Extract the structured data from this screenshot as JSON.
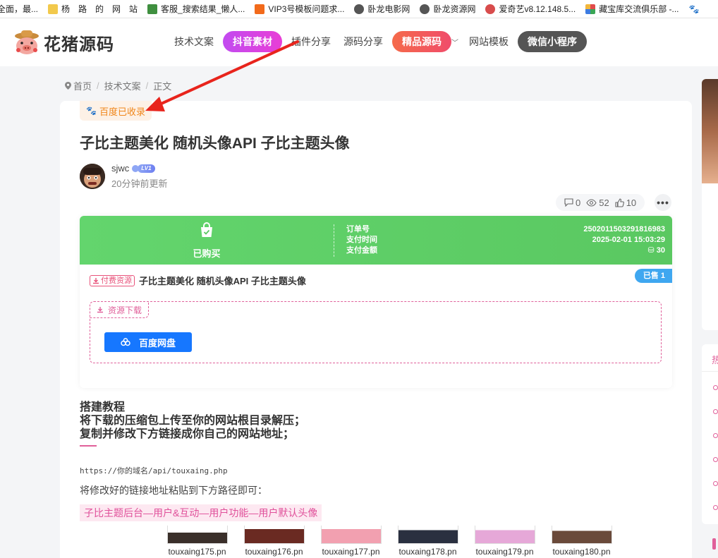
{
  "bookmarks": [
    {
      "label": "全面，最...",
      "icon": "page-icon",
      "color": "#6a8bd8"
    },
    {
      "label": "杨　路　的　网　站",
      "icon": "folder-icon",
      "color": "#f2c94c"
    },
    {
      "label": "客服_搜索结果_懒人...",
      "icon": "site-icon",
      "color": "#3f8f3f"
    },
    {
      "label": "VIP3号模板问题求...",
      "icon": "z-icon",
      "color": "#f26a1b"
    },
    {
      "label": "卧龙电影网",
      "icon": "globe-icon",
      "color": "#555555"
    },
    {
      "label": "卧龙资源网",
      "icon": "globe-icon",
      "color": "#555555"
    },
    {
      "label": "爱奇艺v8.12.148.5...",
      "icon": "site-icon",
      "color": "#d84c4c"
    },
    {
      "label": "藏宝库交流俱乐部 -...",
      "icon": "grid-icon",
      "color": "#e14b4b"
    }
  ],
  "header": {
    "logo_text": "花猪源码",
    "nav": [
      {
        "label": "技术文案",
        "style": "plain"
      },
      {
        "label": "抖音素材",
        "style": "purple"
      },
      {
        "label": "插件分享",
        "style": "plain"
      },
      {
        "label": "源码分享",
        "style": "plain"
      },
      {
        "label": "精品源码",
        "style": "red"
      },
      {
        "label": "网站模板",
        "style": "plain"
      },
      {
        "label": "微信小程序",
        "style": "dark"
      }
    ]
  },
  "breadcrumb": {
    "home": "首页",
    "category": "技术文案",
    "current": "正文"
  },
  "post": {
    "indexed_badge": "百度已收录",
    "title": "子比主题美化 随机头像API 子比主题头像",
    "author": "sjwc",
    "level": "LV1",
    "updated": "20分钟前更新",
    "comments": "0",
    "views": "52",
    "likes": "10"
  },
  "purchase": {
    "status": "已购买",
    "labels": {
      "order": "订单号",
      "time": "支付时间",
      "amount": "支付金额"
    },
    "order_no": "2502011503291816983",
    "pay_time": "2025-02-01 15:03:29",
    "amount": "30",
    "sold": "已售 1",
    "paid_tag": "付费资源",
    "resource_title": "子比主题美化 随机头像API 子比主题头像",
    "download_tab": "资源下载",
    "download_button": "百度网盘"
  },
  "content": {
    "heading_lines": [
      "搭建教程",
      "将下载的压缩包上传至你的网站根目录解压；",
      "复制并修改下方链接成你自己的网站地址；"
    ],
    "url": "https://你的域名/api/touxaing.php",
    "paragraph": "将修改好的链接地址粘贴到下方路径即可：",
    "highlight": "子比主题后台—用户&互动—用户功能—用户默认头像",
    "thumbs": [
      "touxaing175.pn",
      "touxaing176.pn",
      "touxaing177.pn",
      "touxaing178.pn",
      "touxaing179.pn",
      "touxaing180.pn"
    ]
  },
  "sidebar": {
    "hot_heading": "热"
  },
  "colors": {
    "accent_pink": "#e0609a",
    "purchase_green": "#5ac861",
    "download_blue": "#1677ff",
    "annotation_red": "#e8241c"
  }
}
